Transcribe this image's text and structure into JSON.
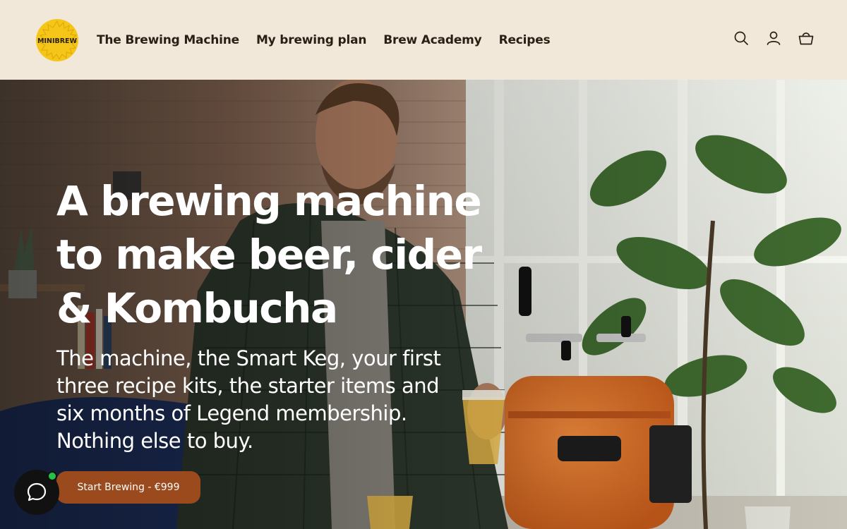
{
  "brand": {
    "logo_text": "MINIBREW"
  },
  "nav": {
    "items": [
      {
        "label": "The Brewing Machine"
      },
      {
        "label": "My brewing plan"
      },
      {
        "label": "Brew Academy"
      },
      {
        "label": "Recipes"
      }
    ]
  },
  "header_icons": [
    "search-icon",
    "account-icon",
    "cart-icon"
  ],
  "hero": {
    "headline": "A brewing machine to make beer, cider & Kombucha",
    "subline": "The machine, the Smart Keg, your first three recipe kits, the starter items and six months of Legend membership. Nothing else to buy.",
    "cta_label": "Start Brewing - €999"
  },
  "colors": {
    "header_bg": "#f1e8da",
    "cta": "#9a4a1c",
    "logo_yellow": "#f5c518",
    "chat_online": "#25c24a"
  }
}
